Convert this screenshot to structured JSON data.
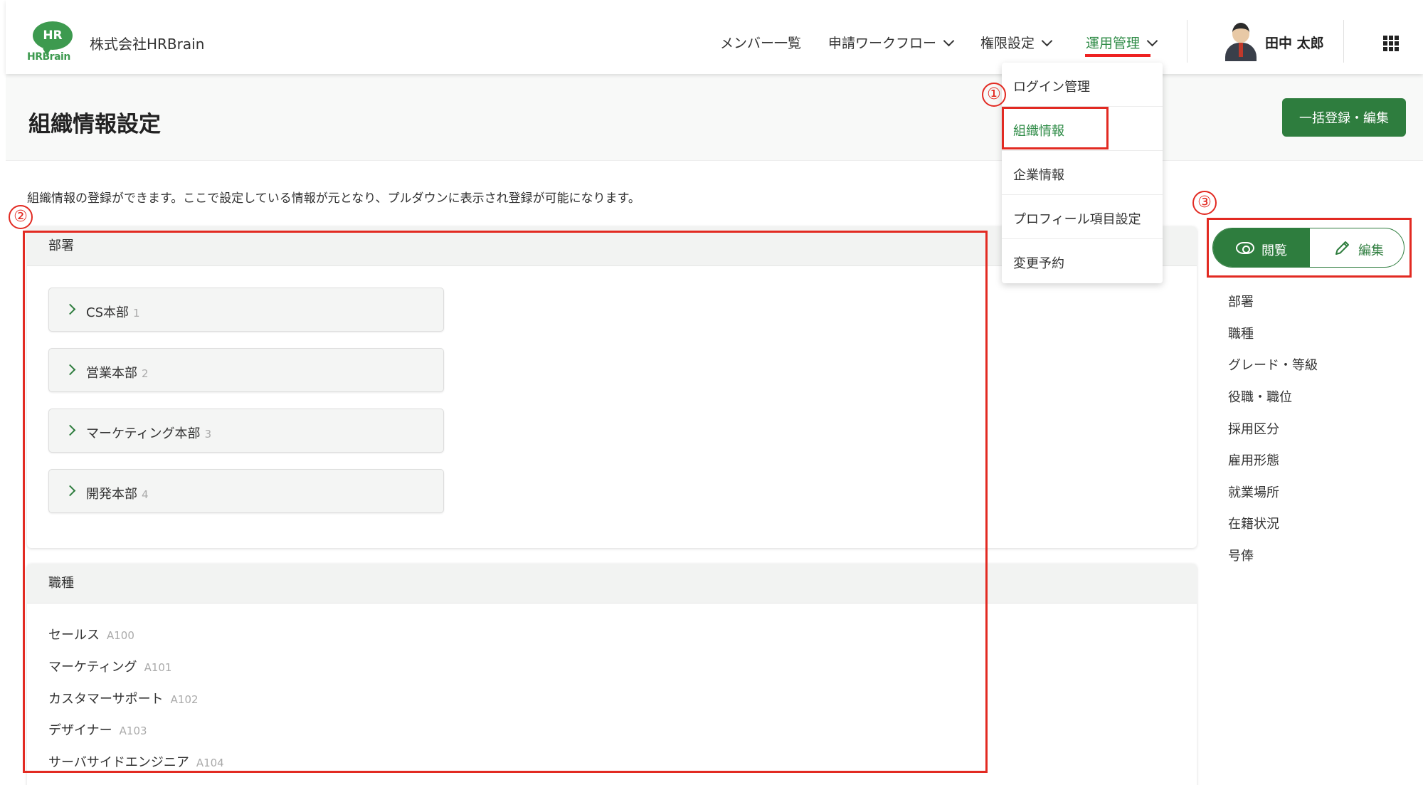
{
  "header": {
    "logo_text": "HR",
    "logo_brand": "HRBrain",
    "company": "株式会社HRBrain",
    "nav": [
      {
        "label": "メンバー一覧"
      },
      {
        "label": "申請ワークフロー"
      },
      {
        "label": "権限設定"
      },
      {
        "label": "運用管理"
      }
    ],
    "user_name": "田中 太郎"
  },
  "dropdown": {
    "items": [
      {
        "label": "ログイン管理"
      },
      {
        "label": "組織情報"
      },
      {
        "label": "企業情報"
      },
      {
        "label": "プロフィール項目設定"
      },
      {
        "label": "変更予約"
      }
    ]
  },
  "page": {
    "title": "組織情報設定",
    "bulk_button": "一括登録・編集",
    "description": "組織情報の登録ができます。ここで設定している情報が元となり、プルダウンに表示され登録が可能になります。"
  },
  "departments": {
    "heading": "部署",
    "items": [
      {
        "name": "CS本部",
        "count": "1"
      },
      {
        "name": "営業本部",
        "count": "2"
      },
      {
        "name": "マーケティング本部",
        "count": "3"
      },
      {
        "name": "開発本部",
        "count": "4"
      }
    ]
  },
  "jobs": {
    "heading": "職種",
    "items": [
      {
        "name": "セールス",
        "code": "A100"
      },
      {
        "name": "マーケティング",
        "code": "A101"
      },
      {
        "name": "カスタマーサポート",
        "code": "A102"
      },
      {
        "name": "デザイナー",
        "code": "A103"
      },
      {
        "name": "サーバサイドエンジニア",
        "code": "A104"
      }
    ]
  },
  "toggle": {
    "view_label": "閲覧",
    "edit_label": "編集"
  },
  "side_nav": [
    "部署",
    "職種",
    "グレード・等級",
    "役職・職位",
    "採用区分",
    "雇用形態",
    "就業場所",
    "在籍状況",
    "号俸"
  ],
  "annotations": [
    "①",
    "②",
    "③"
  ],
  "colors": {
    "accent": "#2e7d3e",
    "annotation": "#e22a22"
  }
}
